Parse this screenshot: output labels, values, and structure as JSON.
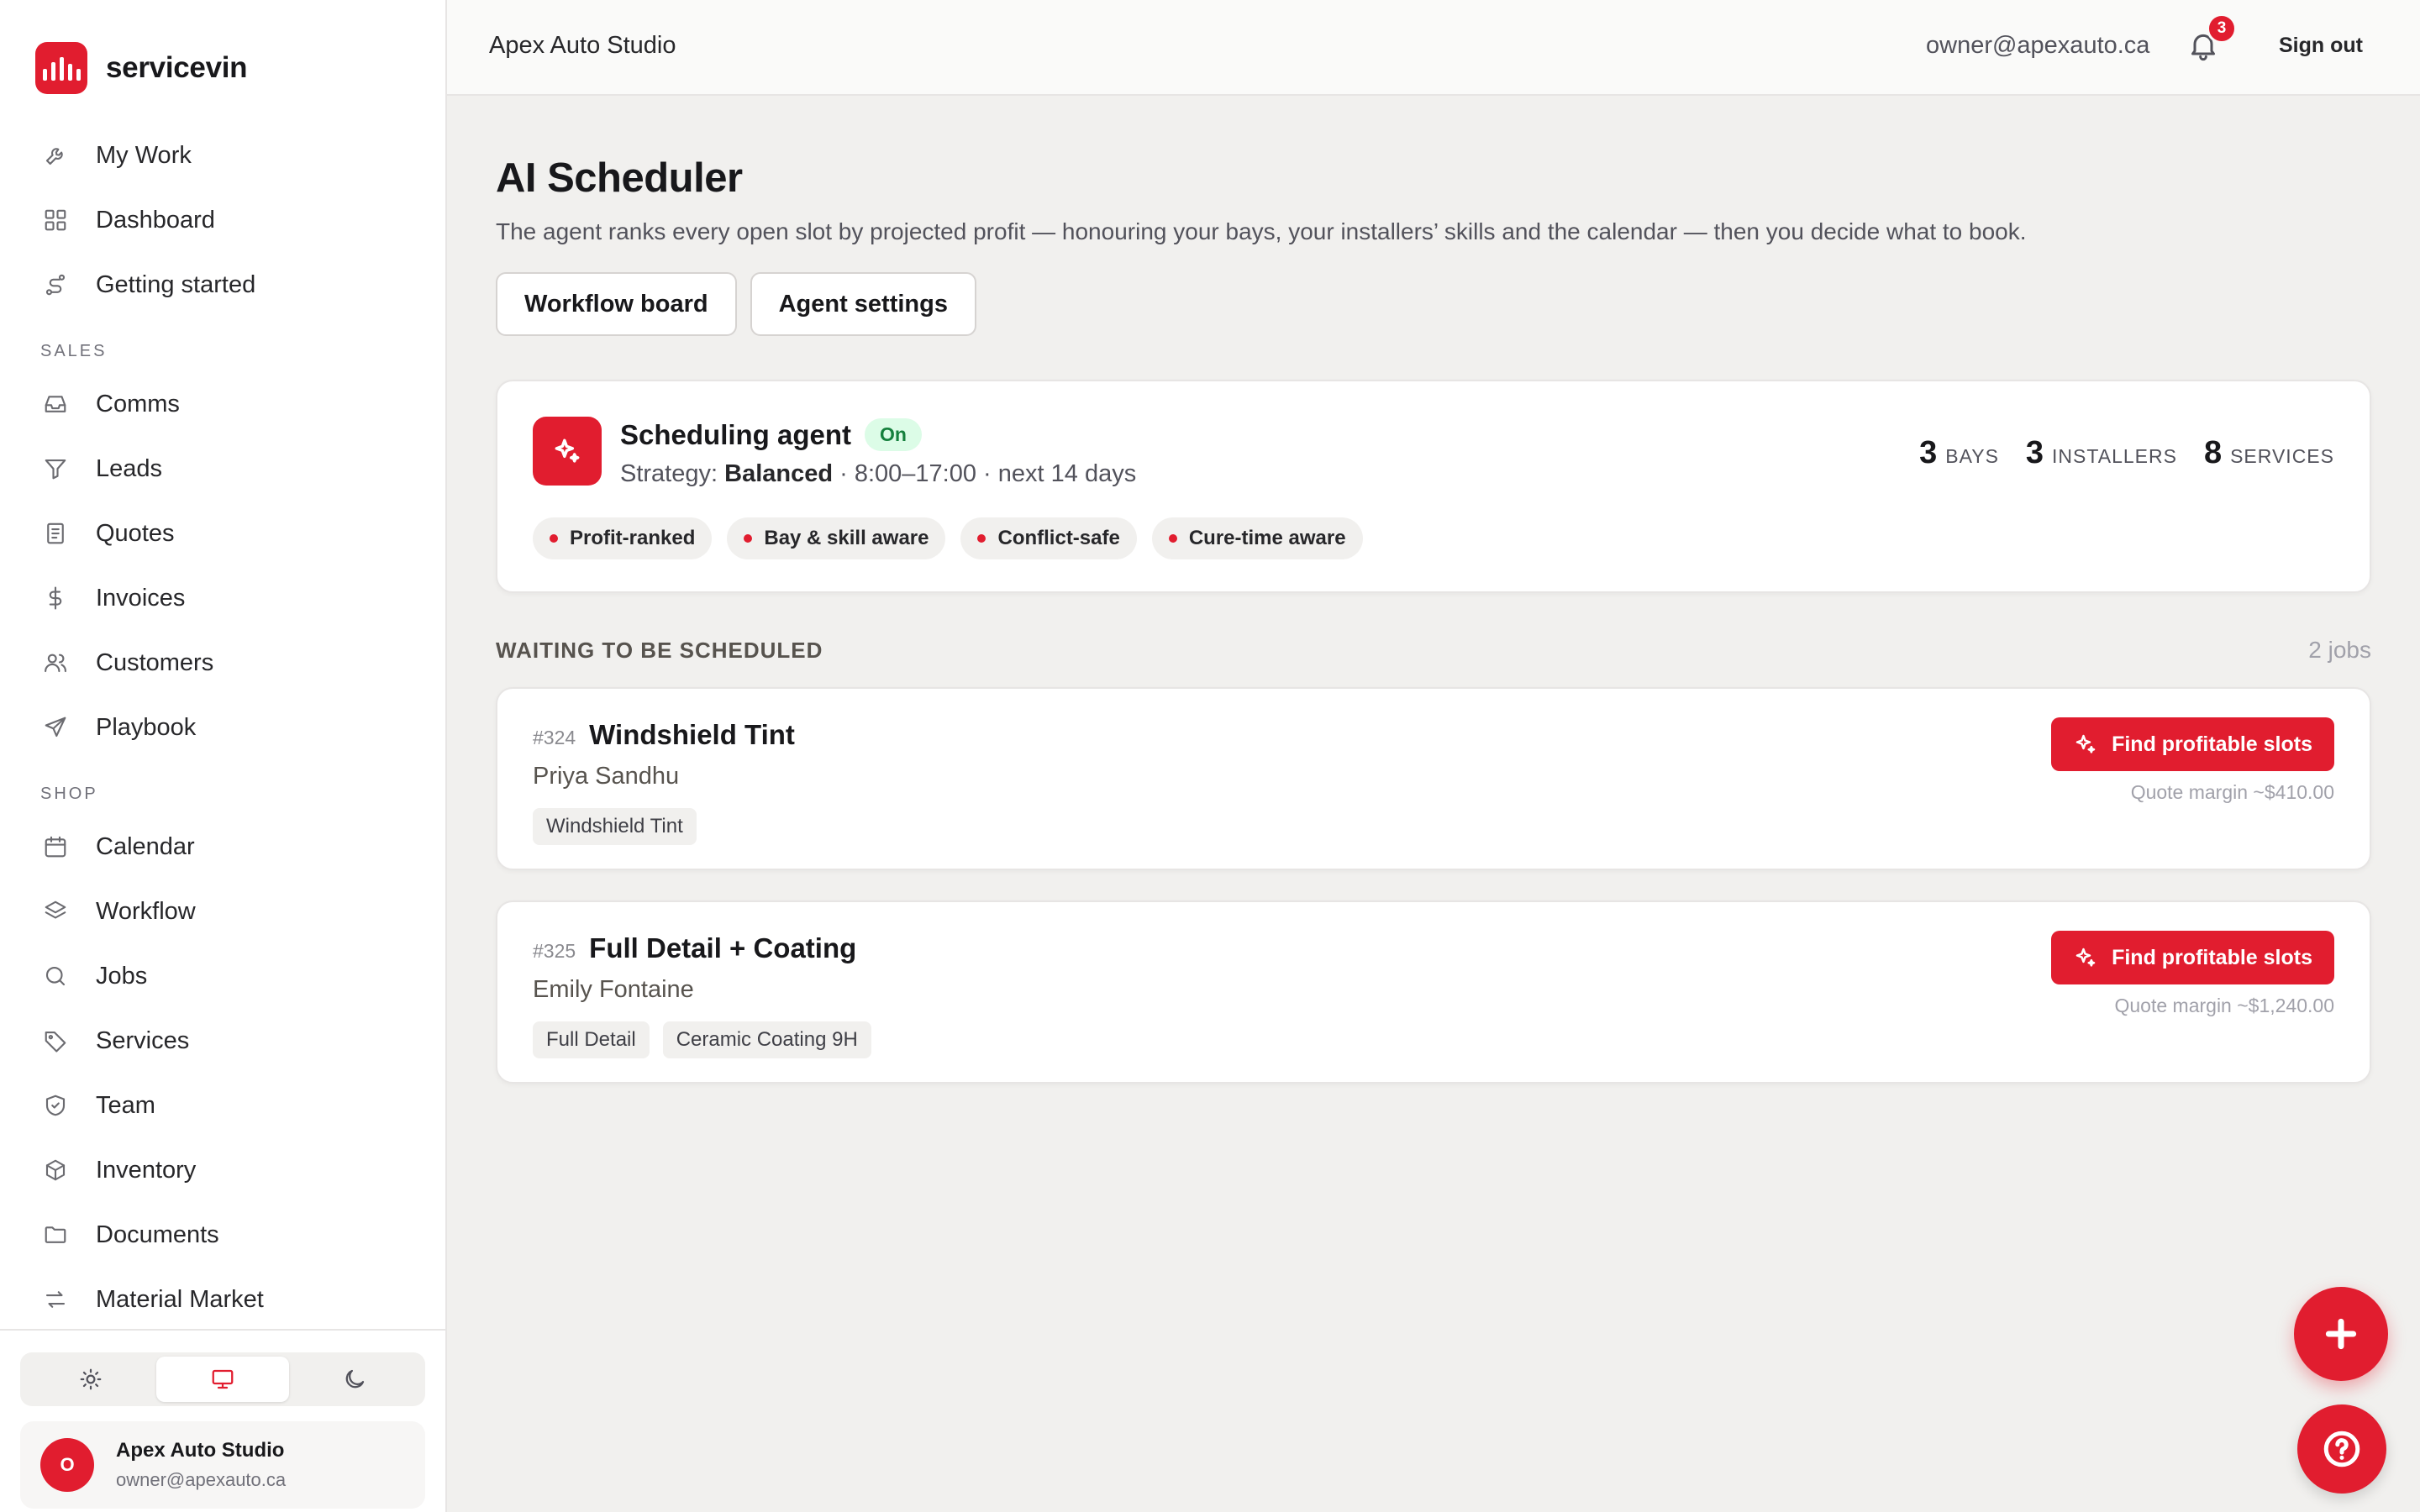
{
  "brand": {
    "name": "servicevin"
  },
  "sidebar": {
    "items_top": [
      {
        "label": "My Work",
        "icon": "wrench-icon"
      },
      {
        "label": "Dashboard",
        "icon": "grid-icon"
      },
      {
        "label": "Getting started",
        "icon": "route-icon"
      }
    ],
    "sales_title": "SALES",
    "sales": [
      {
        "label": "Comms",
        "icon": "inbox-icon"
      },
      {
        "label": "Leads",
        "icon": "filter-icon"
      },
      {
        "label": "Quotes",
        "icon": "document-icon"
      },
      {
        "label": "Invoices",
        "icon": "dollar-icon"
      },
      {
        "label": "Customers",
        "icon": "users-icon"
      },
      {
        "label": "Playbook",
        "icon": "send-icon"
      }
    ],
    "shop_title": "SHOP",
    "shop": [
      {
        "label": "Calendar",
        "icon": "calendar-icon"
      },
      {
        "label": "Workflow",
        "icon": "layers-icon"
      },
      {
        "label": "Jobs",
        "icon": "search-icon"
      },
      {
        "label": "Services",
        "icon": "tag-icon"
      },
      {
        "label": "Team",
        "icon": "shield-icon"
      },
      {
        "label": "Inventory",
        "icon": "box-icon"
      },
      {
        "label": "Documents",
        "icon": "folder-icon"
      },
      {
        "label": "Material Market",
        "icon": "swap-icon"
      }
    ],
    "theme": {
      "active": "system"
    },
    "user": {
      "initial": "O",
      "name": "Apex Auto Studio",
      "email": "owner@apexauto.ca"
    }
  },
  "header": {
    "shop_name": "Apex Auto Studio",
    "email": "owner@apexauto.ca",
    "notifications": "3",
    "sign_out": "Sign out"
  },
  "page": {
    "title": "AI Scheduler",
    "description": "The agent ranks every open slot by projected profit — honouring your bays, your installers’ skills and the calendar — then you decide what to book.",
    "buttons": {
      "workflow": "Workflow board",
      "settings": "Agent settings"
    }
  },
  "agent": {
    "name": "Scheduling agent",
    "status": "On",
    "strategy_label": "Strategy:",
    "strategy_value": "Balanced",
    "strategy_rest": " · 8:00–17:00 · next 14 days",
    "stats": [
      {
        "value": "3",
        "label": "BAYS"
      },
      {
        "value": "3",
        "label": "INSTALLERS"
      },
      {
        "value": "8",
        "label": "SERVICES"
      }
    ],
    "chips": [
      "Profit-ranked",
      "Bay & skill aware",
      "Conflict-safe",
      "Cure-time aware"
    ]
  },
  "queue": {
    "title": "WAITING TO BE SCHEDULED",
    "count": "2 jobs",
    "action_label": "Find profitable slots",
    "jobs": [
      {
        "number": "#324",
        "title": "Windshield Tint",
        "customer": "Priya Sandhu",
        "tags": [
          "Windshield Tint"
        ],
        "margin": "Quote margin ~$410.00"
      },
      {
        "number": "#325",
        "title": "Full Detail + Coating",
        "customer": "Emily Fontaine",
        "tags": [
          "Full Detail",
          "Ceramic Coating 9H"
        ],
        "margin": "Quote margin ~$1,240.00"
      }
    ]
  },
  "colors": {
    "accent": "#e11d2f",
    "status_on_bg": "#dcfce7",
    "status_on_text": "#15803d"
  }
}
